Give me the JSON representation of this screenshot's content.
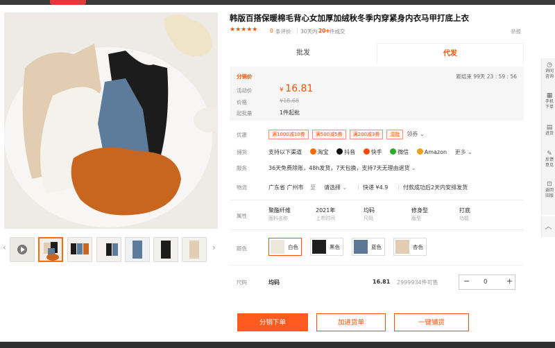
{
  "product": {
    "title": "韩版百搭保暖棉毛背心女加厚加绒秋冬季内穿紧身内衣马甲打底上衣",
    "stars": "★★★★★",
    "reviews_count": "0",
    "reviews_label": "条评价",
    "sold_label_prefix": "30天内",
    "sold_count": "20+",
    "sold_label_suffix": "件成交",
    "report_label": "举报"
  },
  "tabs": [
    {
      "label": "批发",
      "active": false
    },
    {
      "label": "代发",
      "active": true
    }
  ],
  "pricing": {
    "section_label": "分销价",
    "countdown_prefix": "距结束",
    "countdown": "99天 23 : 59 : 56",
    "active_price_label": "活动价",
    "currency": "¥",
    "active_price": "16.81",
    "price_label": "价格",
    "original_price": "¥18.68",
    "moq_label": "起批量",
    "moq": "1件起批"
  },
  "offers": {
    "label": "优惠",
    "coupons": [
      "满1000减10券",
      "满500减5券",
      "满200减3券",
      "混批"
    ],
    "claim_label": "领券"
  },
  "channels": {
    "label": "铺货",
    "intro": "支持以下渠道",
    "items": [
      {
        "name": "淘宝",
        "color": "#ff6a00"
      },
      {
        "name": "抖音",
        "color": "#111111"
      },
      {
        "name": "快手",
        "color": "#ff4906"
      },
      {
        "name": "微信",
        "color": "#2bad2b"
      },
      {
        "name": "Amazon",
        "color": "#f0a01e"
      }
    ],
    "more_label": "更多"
  },
  "service": {
    "label": "服务",
    "text": "36天免费除账，48h发货，7天包换，支持7天无理由退货"
  },
  "logistics": {
    "label": "物流",
    "from": "广东省 广州市",
    "to_label": "至",
    "select_label": "请选择",
    "express": "快递 ¥4.9",
    "note": "付款成功后2天内安排发货"
  },
  "attributes": {
    "label": "属性",
    "items": [
      {
        "value": "聚酯纤维",
        "key": "面料名称"
      },
      {
        "value": "2021年",
        "key": "上市时间"
      },
      {
        "value": "均码",
        "key": "尺码"
      },
      {
        "value": "修身型",
        "key": "版型"
      },
      {
        "value": "打底",
        "key": "功能"
      }
    ]
  },
  "colors": {
    "label": "颜色",
    "options": [
      {
        "name": "白色",
        "swatch": "#ece6dc",
        "selected": true
      },
      {
        "name": "黑色",
        "swatch": "#1e1e1e",
        "selected": false
      },
      {
        "name": "蓝色",
        "swatch": "#5b7896",
        "selected": false
      },
      {
        "name": "杏色",
        "swatch": "#e3cdb2",
        "selected": false
      }
    ]
  },
  "size": {
    "label": "尺码",
    "value": "均码",
    "price": "16.81",
    "stock": "2999934件可售",
    "quantity": "0",
    "minus": "−",
    "plus": "+"
  },
  "actions": {
    "distribute": "分销下单",
    "add_to_list": "加进货单",
    "one_click": "一键铺货"
  },
  "sidebar": [
    {
      "icon": "◷",
      "label": "询问\n咨询"
    },
    {
      "icon": "▦",
      "label": "手机\n下单"
    },
    {
      "icon": "▤",
      "label": "进货"
    },
    {
      "icon": "✎",
      "label": "反馈\n意见"
    },
    {
      "icon": "⊡",
      "label": "返回\n旧版"
    }
  ],
  "sidebar_top": "︿",
  "thumb_prev": "‹",
  "thumb_next": "›"
}
